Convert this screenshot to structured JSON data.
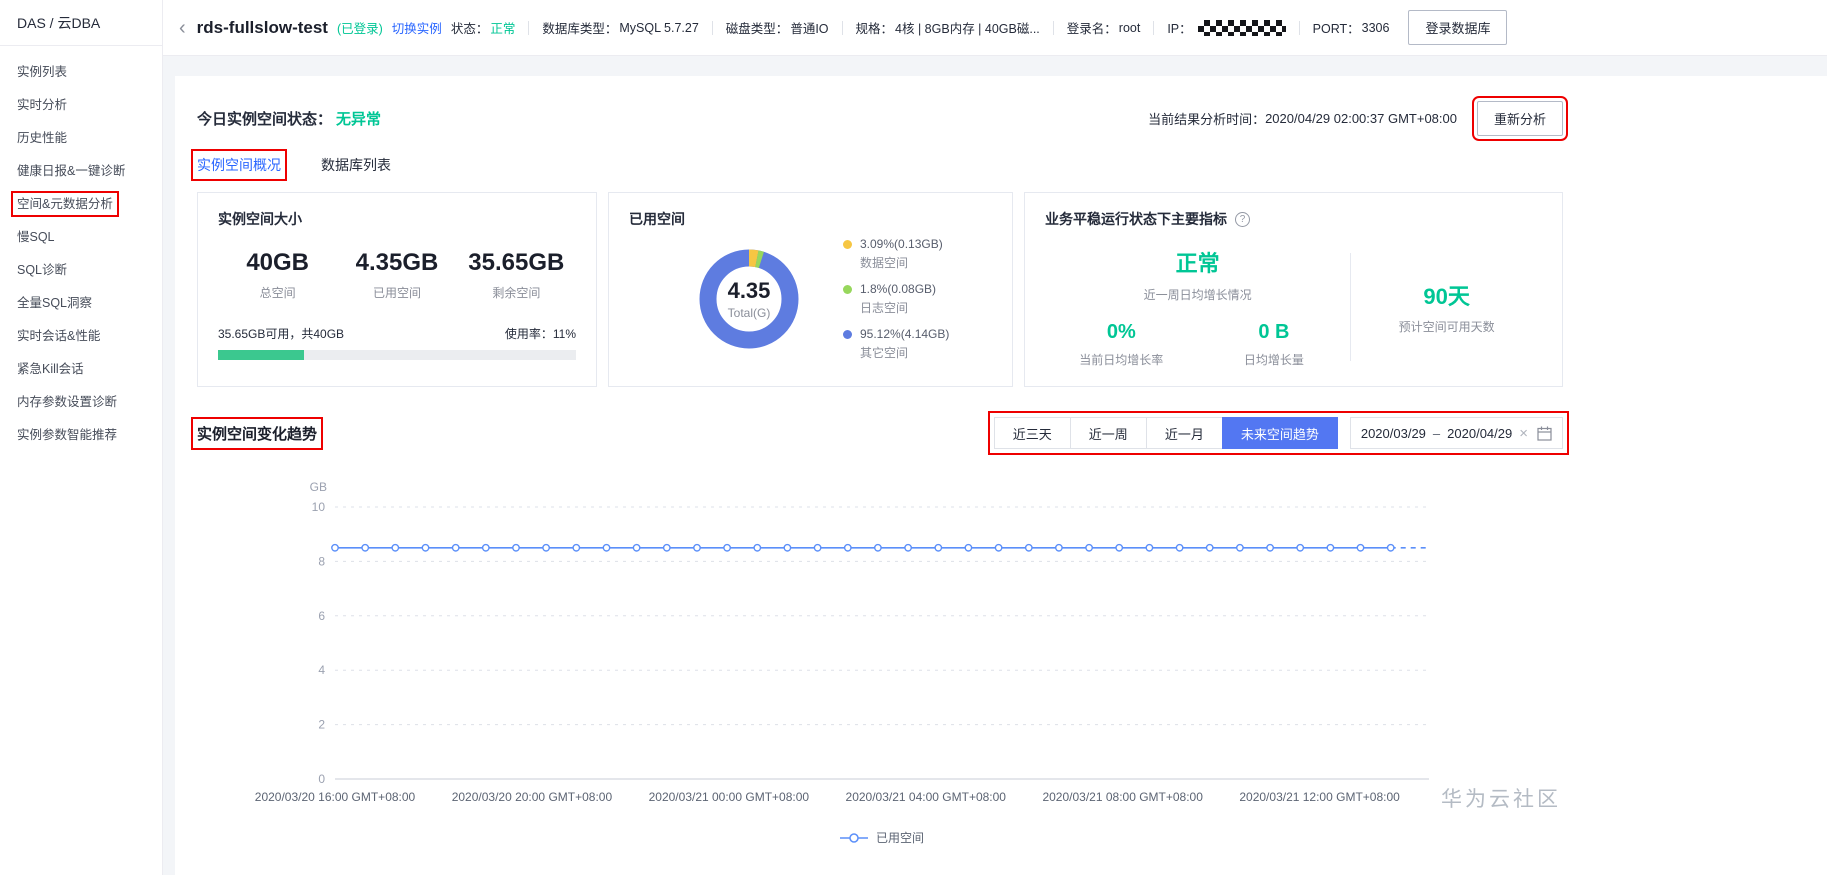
{
  "colors": {
    "green": "#00c695",
    "link_blue": "#2a66ff",
    "primary_button": "#5377f2",
    "chart_line": "#5b8ff9",
    "progress_fill": "#3bc88f",
    "annotation_red": "#ee0000"
  },
  "icons": {
    "back": "‹",
    "help": "?",
    "clear": "×"
  },
  "sidebar": {
    "brand": "DAS / 云DBA",
    "items": [
      {
        "label": "实例列表",
        "active": false
      },
      {
        "label": "实时分析",
        "active": false
      },
      {
        "label": "历史性能",
        "active": false
      },
      {
        "label": "健康日报&一键诊断",
        "active": false
      },
      {
        "label": "空间&元数据分析",
        "active": true
      },
      {
        "label": "慢SQL",
        "active": false
      },
      {
        "label": "SQL诊断",
        "active": false
      },
      {
        "label": "全量SQL洞察",
        "active": false
      },
      {
        "label": "实时会话&性能",
        "active": false
      },
      {
        "label": "紧急Kill会话",
        "active": false
      },
      {
        "label": "内存参数设置诊断",
        "active": false
      },
      {
        "label": "实例参数智能推荐",
        "active": false
      }
    ]
  },
  "header": {
    "title": "rds-fullslow-test",
    "login_status": "(已登录)",
    "switch_instance": "切换实例",
    "status_label": "状态：",
    "status_value": "正常",
    "db_type_label": "数据库类型：",
    "db_type_value": "MySQL 5.7.27",
    "disk_type_label": "磁盘类型：",
    "disk_type_value": "普通IO",
    "spec_label": "规格：",
    "spec_value": "4核 | 8GB内存 | 40GB磁...",
    "login_name_label": "登录名：",
    "login_name_value": "root",
    "ip_label": "IP：",
    "port_label": "PORT：",
    "port_value": "3306",
    "login_db_button": "登录数据库"
  },
  "overview": {
    "status_label": "今日实例空间状态：",
    "status_value": "无异常",
    "analysis_time_label": "当前结果分析时间：",
    "analysis_time_value": "2020/04/29 02:00:37 GMT+08:00",
    "reanalyze_button": "重新分析"
  },
  "tabs": [
    {
      "label": "实例空间概况",
      "active": true
    },
    {
      "label": "数据库列表",
      "active": false
    }
  ],
  "cards": {
    "space_size": {
      "title": "实例空间大小",
      "stats": [
        {
          "value": "40GB",
          "label": "总空间"
        },
        {
          "value": "4.35GB",
          "label": "已用空间"
        },
        {
          "value": "35.65GB",
          "label": "剩余空间"
        }
      ],
      "usage_left_text": "35.65GB可用，共40GB",
      "usage_rate_text": "使用率：11%",
      "usage_bar_percent": 24
    },
    "used_space": {
      "title": "已用空间",
      "total_value": "4.35",
      "total_label": "Total(G)",
      "legend": [
        {
          "text": "3.09%(0.13GB)",
          "label": "数据空间",
          "value": 3.09,
          "color": "#f6c643"
        },
        {
          "text": "1.8%(0.08GB)",
          "label": "日志空间",
          "value": 1.8,
          "color": "#97d75c"
        },
        {
          "text": "95.12%(4.14GB)",
          "label": "其它空间",
          "value": 95.12,
          "color": "#5e7ce0"
        }
      ]
    },
    "metrics": {
      "title": "业务平稳运行状态下主要指标",
      "status_value": "正常",
      "status_desc": "近一周日均增长情况",
      "growth_rate_value": "0%",
      "growth_rate_label": "当前日均增长率",
      "growth_amount_value": "0 B",
      "growth_amount_label": "日均增长量",
      "days_value": "90天",
      "days_label": "预计空间可用天数"
    }
  },
  "trend": {
    "title": "实例空间变化趋势",
    "range_buttons": [
      {
        "label": "近三天",
        "active": false
      },
      {
        "label": "近一周",
        "active": false
      },
      {
        "label": "近一月",
        "active": false
      },
      {
        "label": "未来空间趋势",
        "active": true
      }
    ],
    "date_start": "2020/03/29",
    "date_separator": "–",
    "date_end": "2020/04/29"
  },
  "chart_data": {
    "type": "line",
    "title": "实例空间变化趋势",
    "xlabel": "",
    "ylabel": "GB",
    "ylim": [
      0,
      10
    ],
    "yticks": [
      0,
      2,
      4,
      6,
      8,
      10
    ],
    "x_tick_labels": [
      "2020/03/20 16:00 GMT+08:00",
      "2020/03/20 20:00 GMT+08:00",
      "2020/03/21 00:00 GMT+08:00",
      "2020/03/21 04:00 GMT+08:00",
      "2020/03/21 08:00 GMT+08:00",
      "2020/03/21 12:00 GMT+08:00"
    ],
    "grid": "dashed horizontal gridlines",
    "legend_position": "bottom",
    "series": [
      {
        "name": "已用空间",
        "color": "#5b8ff9",
        "marker": "hollow-circle",
        "predicted_tail_dashed": true,
        "values": [
          8.5,
          8.5,
          8.5,
          8.5,
          8.5,
          8.5,
          8.5,
          8.5,
          8.5,
          8.5,
          8.5,
          8.5,
          8.5,
          8.5,
          8.5,
          8.5,
          8.5,
          8.5,
          8.5,
          8.5,
          8.5,
          8.5,
          8.5,
          8.5,
          8.5,
          8.5,
          8.5,
          8.5,
          8.5,
          8.5,
          8.5,
          8.5,
          8.5,
          8.5,
          8.5,
          8.5
        ]
      }
    ]
  },
  "watermark": "华为云社区"
}
